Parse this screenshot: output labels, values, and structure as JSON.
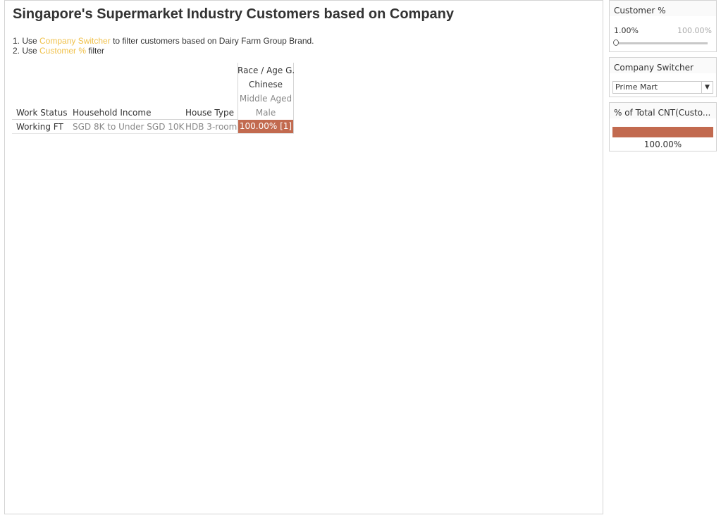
{
  "dashboard": {
    "title": "Singapore's Supermarket Industry Customers based on Company",
    "instructions": [
      {
        "prefix": "1. Use ",
        "highlight": "Company Switcher",
        "suffix": " to filter customers based on Dairy Farm Group Brand."
      },
      {
        "prefix": "2. Use ",
        "highlight": "Customer %",
        "suffix": " filter"
      }
    ],
    "highlight_color": "#f0c14b"
  },
  "table": {
    "column_header_title": "Race / Age G..",
    "column_headers": [
      "Chinese",
      "Middle Aged",
      "Male"
    ],
    "row_headers": [
      "Work Status",
      "Household Income",
      "House Type"
    ],
    "rows": [
      {
        "work_status": "Working FT",
        "household_income": "SGD 8K to Under SGD 10K",
        "house_type": "HDB 3-room",
        "value": "100.00%  [1]"
      }
    ],
    "cell_color": "#c26a4f"
  },
  "filters": {
    "customer_pct": {
      "title": "Customer %",
      "min_label": "1.00%",
      "max_label": "100.00%",
      "min_value": 0.01,
      "max_value": 1.0
    },
    "company_switcher": {
      "title": "Company Switcher",
      "selected": "Prime Mart",
      "arrow_icon": "chevron-down-icon"
    },
    "legend": {
      "title": "% of Total CNT(Custo...",
      "value": "100.00%",
      "color": "#c26a4f"
    }
  }
}
